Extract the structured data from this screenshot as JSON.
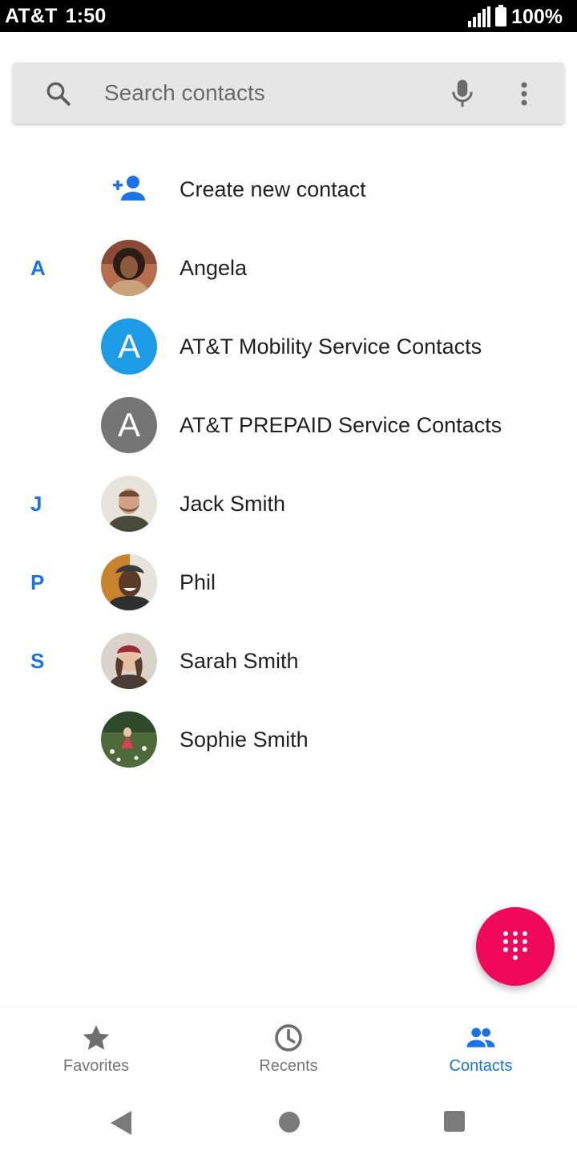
{
  "status_bar": {
    "carrier": "AT&T",
    "time": "1:50",
    "battery": "100%"
  },
  "search": {
    "placeholder": "Search contacts"
  },
  "create_contact": {
    "label": "Create new contact"
  },
  "contacts": [
    {
      "section": "A",
      "name": "Angela",
      "avatar": "photo"
    },
    {
      "section": "",
      "name": "AT&T Mobility Service Contacts",
      "avatar": "letter",
      "initial": "A",
      "color": "#1e9be6"
    },
    {
      "section": "",
      "name": "AT&T PREPAID Service Contacts",
      "avatar": "letter",
      "initial": "A",
      "color": "#757575"
    },
    {
      "section": "J",
      "name": "Jack Smith",
      "avatar": "photo"
    },
    {
      "section": "P",
      "name": "Phil",
      "avatar": "photo"
    },
    {
      "section": "S",
      "name": "Sarah Smith",
      "avatar": "photo"
    },
    {
      "section": "",
      "name": "Sophie Smith",
      "avatar": "photo"
    }
  ],
  "bottom_nav": {
    "tabs": [
      {
        "label": "Favorites",
        "icon": "star-icon",
        "active": false
      },
      {
        "label": "Recents",
        "icon": "clock-icon",
        "active": false
      },
      {
        "label": "Contacts",
        "icon": "people-icon",
        "active": true
      }
    ]
  },
  "colors": {
    "accent": "#1a73e8",
    "fab": "#f0085a"
  }
}
